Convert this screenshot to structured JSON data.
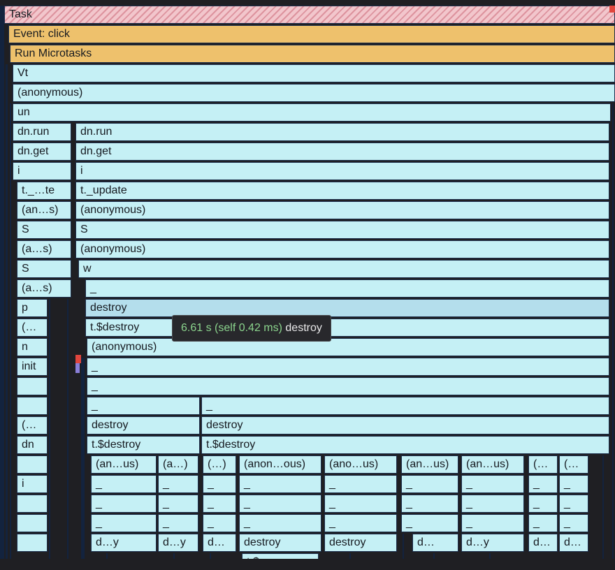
{
  "colors": {
    "frame": "#c5f0f5",
    "frame_highlight": "#b4deec",
    "event": "#eec16c",
    "task_stripe": "#f2c6cc",
    "border": "#1d2f4c",
    "tooltip_bg": "#28282c",
    "tooltip_time": "#8bd48d"
  },
  "task_label": "Task",
  "event_label": "Event: click",
  "microtasks_label": "Run Microtasks",
  "frames": {
    "vt": "Vt",
    "anon1": "(anonymous)",
    "un": "un",
    "dnrun_a": "dn.run",
    "dnrun_b": "dn.run",
    "dnget_a": "dn.get",
    "dnget_b": "dn.get",
    "i_a": "i",
    "i_b": "i",
    "tupd_a": "t._…te",
    "tupd_b": "t._update",
    "anon2_a": "(an…s)",
    "anon2_b": "(anonymous)",
    "s_a": "S",
    "s_b": "S",
    "anon3_a": "(a…s)",
    "anon3_b": "(anonymous)",
    "s2_a": "S",
    "w": "w",
    "anon4_a": "(a…s)",
    "us1": "_",
    "p": "p",
    "destroy_hl": "destroy",
    "paren_a": "(…",
    "tdestroy_a": "t.$destroy",
    "n": "n",
    "anon5": "(anonymous)",
    "init": "init",
    "us2": "_",
    "us3": "_",
    "us4a": "_",
    "us4b": "_",
    "paren_b": "(…",
    "destroy_b": "destroy",
    "destroy_c": "destroy",
    "dn": "dn",
    "tdestroy_b": "t.$destroy",
    "tdestroy_c": "t.$destroy",
    "r23": [
      "(an…us)",
      "(a…)",
      "(…)",
      "(anon…ous)",
      "(ano…us)",
      "(an…us)",
      "(an…us)",
      "(…",
      "(…"
    ],
    "i_c": "i",
    "r24": [
      "_",
      "_",
      "_",
      "_",
      "_",
      "_",
      "_",
      "_",
      "_"
    ],
    "r25": [
      "_",
      "_",
      "_",
      "_",
      "_",
      "_",
      "_",
      "_",
      "_"
    ],
    "r26": [
      "_",
      "_",
      "_",
      "_",
      "_",
      "_",
      "_",
      "_",
      "_"
    ],
    "r27": [
      "d…y",
      "d…y",
      "d…",
      "destroy",
      "destroy",
      "d…",
      "d…y",
      "d…",
      "d…"
    ],
    "r28": [
      "t.$…roy"
    ]
  },
  "tooltip": {
    "time": "6.61 s (self 0.42 ms)",
    "name": "destroy"
  }
}
